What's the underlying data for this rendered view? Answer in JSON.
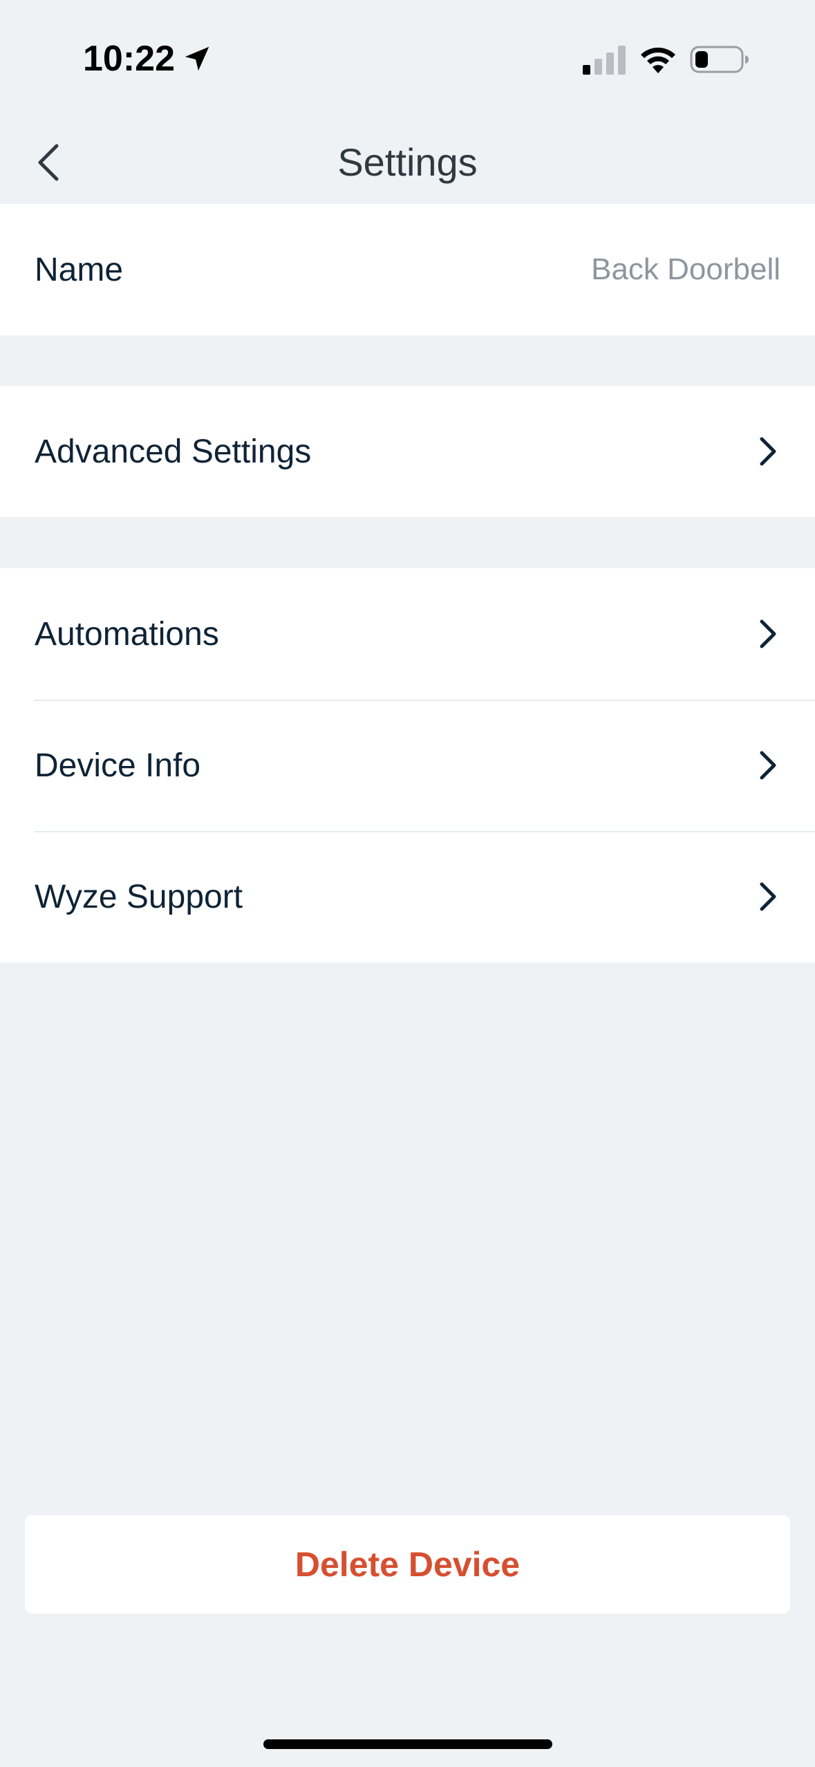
{
  "status_bar": {
    "time": "10:22"
  },
  "header": {
    "title": "Settings"
  },
  "groups": [
    {
      "rows": [
        {
          "label": "Name",
          "value": "Back Doorbell"
        }
      ]
    },
    {
      "rows": [
        {
          "label": "Advanced Settings"
        }
      ]
    },
    {
      "rows": [
        {
          "label": "Automations"
        },
        {
          "label": "Device Info"
        },
        {
          "label": "Wyze Support"
        }
      ]
    }
  ],
  "delete_button": {
    "label": "Delete Device"
  },
  "colors": {
    "background": "#eff2f5",
    "card": "#ffffff",
    "text": "#0f2336",
    "secondary_text": "#8d969e",
    "destructive": "#d64f31"
  },
  "icons": {
    "back": "chevron-left-icon",
    "row_disclosure": "chevron-right-icon",
    "location": "location-arrow-icon",
    "signal": "cellular-signal-icon",
    "wifi": "wifi-icon",
    "battery": "battery-icon"
  }
}
